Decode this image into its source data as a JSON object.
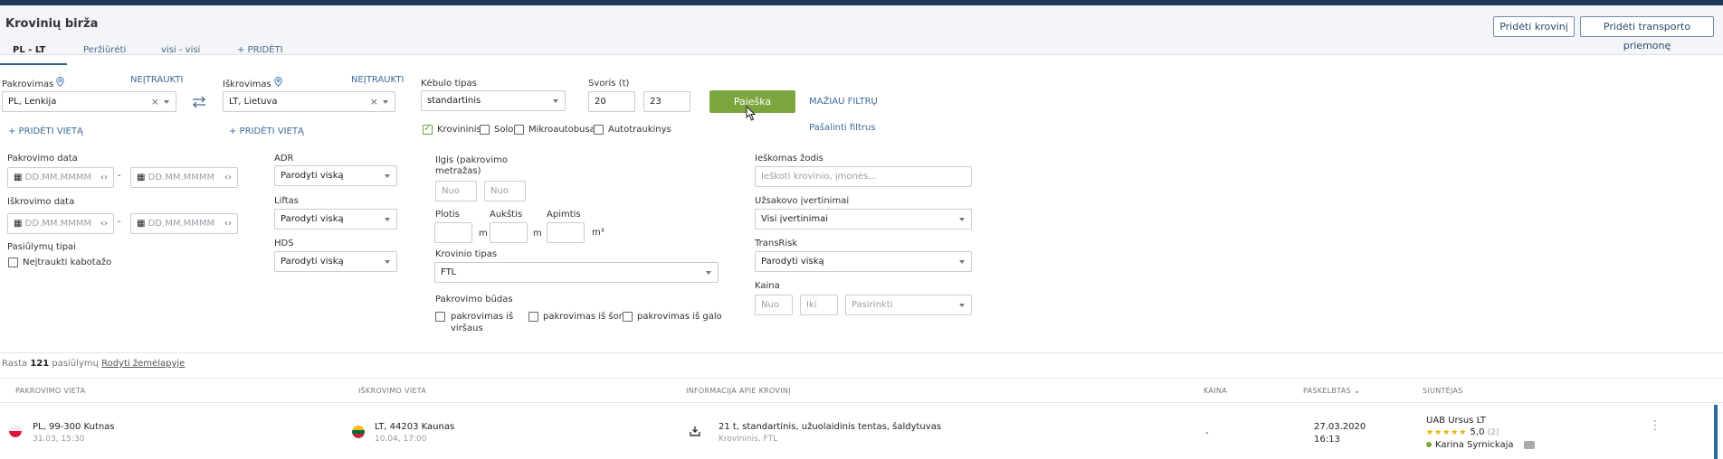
{
  "header": {
    "title": "Krovinių birža",
    "add_cargo": "Pridėti krovinį",
    "add_vehicle": "Pridėti transporto priemonę"
  },
  "tabs": [
    {
      "label": "PL - LT"
    },
    {
      "label": "Peržiūrėti"
    },
    {
      "label": "visi - visi"
    },
    {
      "label": "+ PRIDĖTI"
    }
  ],
  "filters": {
    "loading_label": "Pakrovimas",
    "loading_exclude": "NEĮTRAUKTI",
    "loading_value": "PL,  Lenkija",
    "loading_add": "+ PRIDĖTI VIETĄ",
    "unloading_label": "Iškrovimas",
    "unloading_exclude": "NEĮTRAUKTI",
    "unloading_value": "LT,  Lietuva",
    "unloading_add": "+ PRIDĖTI VIETĄ",
    "body_type_label": "Kėbulo tipas",
    "body_type_value": "standartinis",
    "weight_label": "Svoris (t)",
    "weight_from": "20",
    "weight_to": "23",
    "search_btn": "Paieška",
    "fewer_filters": "MAŽIAU FILTRŲ",
    "remove_filters": "Pašalinti filtrus",
    "vehicle_types": [
      "Krovininis",
      "Solo",
      "Mikroautobusas",
      "Autotraukinys"
    ],
    "loading_date_label": "Pakrovimo data",
    "unloading_date_label": "Iškrovimo data",
    "date_placeholder": "DD.MM.MMMM",
    "offer_types_label": "Pasiūlymų tipai",
    "exclude_cabotage": "Neįtraukti kabotažo",
    "adr_label": "ADR",
    "adr_value": "Parodyti viską",
    "lift_label": "Liftas",
    "lift_value": "Parodyti viską",
    "hds_label": "HDS",
    "hds_value": "Parodyti viską",
    "length_label_1": "Ilgis (pakrovimo",
    "length_label_2": "metražas)",
    "from_ph": "Nuo",
    "width_label": "Plotis",
    "height_label": "Aukštis",
    "volume_label": "Apimtis",
    "unit_m": "m",
    "unit_m3": "m³",
    "cargo_type_label": "Krovinio tipas",
    "cargo_type_value": "FTL",
    "loading_method_label": "Pakrovimo būdas",
    "loading_methods": [
      "pakrovimas iš",
      "viršaus",
      "pakrovimas iš šono",
      "pakrovimas iš galo"
    ],
    "keyword_label": "Ieškomas žodis",
    "keyword_placeholder": "Ieškoti krovinio, įmonės...",
    "rating_label": "Užsakovo įvertinimai",
    "rating_value": "Visi įvertinimai",
    "transrisk_label": "TransRisk",
    "transrisk_value": "Parodyti viską",
    "price_label": "Kaina",
    "price_from_ph": "Nuo",
    "price_to_ph": "Iki",
    "price_select": "Pasirinkti"
  },
  "results": {
    "found_prefix": "Rasta",
    "count": "121",
    "found_suffix": "pasiūlymų",
    "show_map": "Rodyti žemėlapyje"
  },
  "table": {
    "headers": [
      "PAKROVIMO VIETA",
      "IŠKROVIMO VIETA",
      "INFORMACIJA APIE KROVINĮ",
      "KAINA",
      "PASKELBTAS",
      "SIUNTĖJAS"
    ],
    "rows": [
      {
        "from_place": "PL, 99-300 Kutnas",
        "from_date": "31.03, 15:30",
        "to_place": "LT, 44203 Kaunas",
        "to_date": "10.04, 17:00",
        "info": "21 t, standartinis, užuolaidinis tentas, šaldytuvas",
        "info_sub": "Krovininis, FTL",
        "price": "-",
        "published_date": "27.03.2020",
        "published_time": "16:13",
        "sender": "UAB Ursus LT",
        "stars": "★★★★★",
        "rating": "5,0",
        "reviews": "(2)",
        "contact": "Karina Syrnickaja"
      }
    ]
  },
  "colors": {
    "topbar": "#1c3a55",
    "accent_green": "#7ba63e",
    "link_blue": "#3c6a98"
  }
}
